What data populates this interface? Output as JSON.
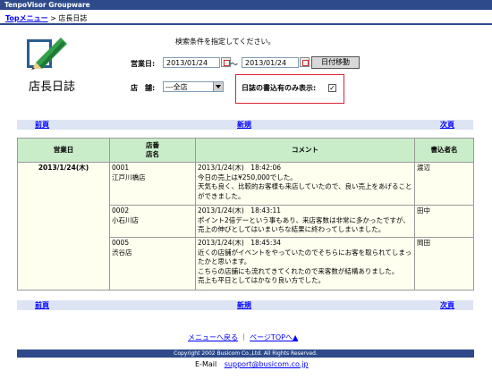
{
  "app": {
    "title": "TenpoVisor Groupware"
  },
  "breadcrumb": {
    "home": "Topメニュー",
    "sep": ">",
    "current": "店長日誌"
  },
  "page_title": "店長日誌",
  "search": {
    "hint": "検索条件を指定してください。",
    "date_label": "営業日:",
    "date_from": "2013/01/24",
    "range_sep": "～",
    "date_to": "2013/01/24",
    "date_move_button": "日付移動",
    "store_label": "店　舗:",
    "store_value": "---全店",
    "only_with_entries_label": "日誌の書込有のみ表示:",
    "only_with_entries_checked": "✓"
  },
  "nav": {
    "prev": "前頁",
    "new": "新規",
    "next": "次頁"
  },
  "table": {
    "headers": {
      "date": "営業日",
      "store": "店番\n店名",
      "comment": "コメント",
      "author": "書込者名"
    },
    "date_value": "2013/1/24(木)",
    "rows": [
      {
        "store_no": "0001",
        "store_name": "江戸川橋店",
        "time": "2013/1/24(木)　18:42:06",
        "comment": "今日の売上は¥250,000でした。\n天気も良く、比較的お客様も来店していたので、良い売上をあげることができました。",
        "author": "渡辺"
      },
      {
        "store_no": "0002",
        "store_name": "小石川店",
        "time": "2013/1/24(木)　18:43:11",
        "comment": "ポイント2倍デーという事もあり、来店客数は非常に多かったですが、売上の伸びとしてはいまいちな結果に終わってしまいました。",
        "author": "田中"
      },
      {
        "store_no": "0005",
        "store_name": "渋谷店",
        "time": "2013/1/24(木)　18:45:34",
        "comment": "近くの店舗がイベントをやっていたのでそちらにお客を取られてしまったかと思います。\nこちらの店舗にも流れてきてくれたので来客数が結構ありました。\n売上も平日としてはかなり良い方でした。",
        "author": "岡田"
      }
    ]
  },
  "footer": {
    "menu_back": "メニューへ戻る",
    "sep": "｜",
    "page_top": "ページTOPへ▲",
    "copyright": "Copyright 2002 Busicom Co.,Ltd. All Rights Reserved.",
    "email_label": "E-Mail",
    "email": "support@busicom.co.jp"
  },
  "colors": {
    "header_bar": "#2e4a8b",
    "table_header": "#c9ecc9",
    "nav_bar": "#dde4f4",
    "highlight_box": "#d22233"
  }
}
